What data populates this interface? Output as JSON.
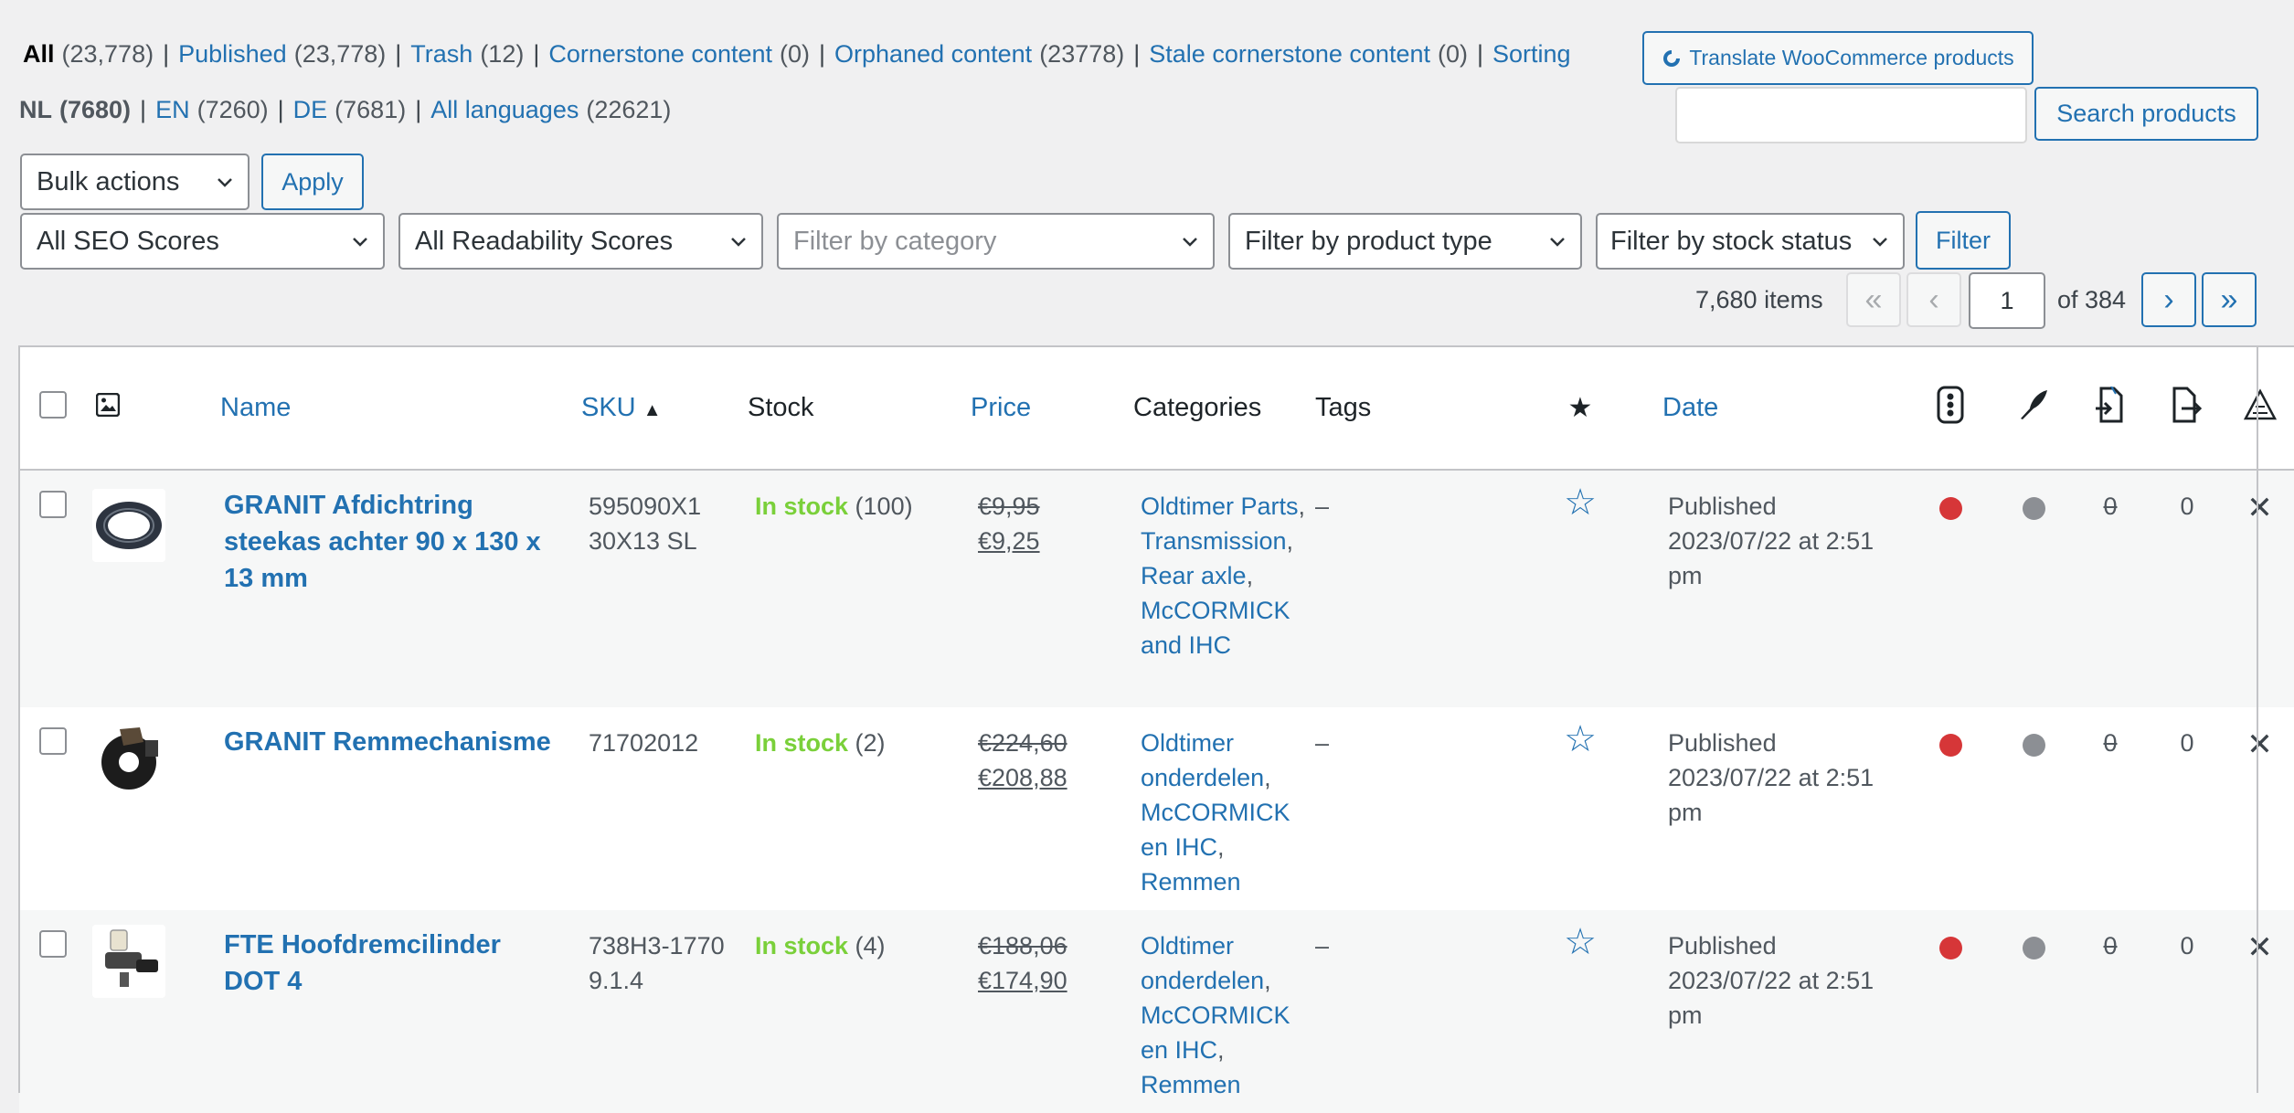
{
  "views": [
    {
      "label": "All",
      "count": "(23,778)",
      "current": true
    },
    {
      "label": "Published",
      "count": "(23,778)"
    },
    {
      "label": "Trash",
      "count": "(12)"
    },
    {
      "label": "Cornerstone content",
      "count": " (0)"
    },
    {
      "label": "Orphaned content",
      "count": " (23778)"
    },
    {
      "label": "Stale cornerstone content",
      "count": " (0)"
    },
    {
      "label": "Sorting",
      "count": ""
    }
  ],
  "translate_button": "Translate WooCommerce products",
  "languages": [
    {
      "label": "NL",
      "count": "(7680)",
      "current": true
    },
    {
      "label": "EN",
      "count": "(7260)"
    },
    {
      "label": "DE",
      "count": "(7681)"
    },
    {
      "label": "All languages",
      "count": "(22621)"
    }
  ],
  "search": {
    "value": "",
    "button": "Search products"
  },
  "bulk": {
    "selected": "Bulk actions",
    "apply": "Apply"
  },
  "filters": {
    "seo": "All SEO Scores",
    "readability": "All Readability Scores",
    "category": "Filter by category",
    "product_type": "Filter by product type",
    "stock": "Filter by stock status",
    "button": "Filter"
  },
  "pagination": {
    "items": "7,680 items",
    "first": "«",
    "prev": "‹",
    "current": "1",
    "of": "of 384",
    "next": "›",
    "last": "»"
  },
  "columns": {
    "name": "Name",
    "sku": "SKU",
    "stock": "Stock",
    "price": "Price",
    "categories": "Categories",
    "tags": "Tags",
    "date": "Date"
  },
  "icons": {
    "thumb": "image-icon",
    "featured": "star-icon",
    "seo": "traffic-light-icon",
    "readability": "quill-icon",
    "links_in": "incoming-links-icon",
    "links_out": "outgoing-links-icon",
    "translate": "translate-icon"
  },
  "colors": {
    "link": "#2271b1",
    "instock": "#7ad03a",
    "seo_bad": "#d63638",
    "readability_na": "#8c8f94"
  },
  "products": [
    {
      "name": "GRANIT Afdichtring steekas achter 90 x 130 x 13 mm",
      "sku": "595090X1 30X13 SL",
      "stock_label": "In stock",
      "stock_qty": "(100)",
      "price_old": "€9,95",
      "price_new": "€9,25",
      "categories": [
        "Oldtimer Parts",
        "Transmission",
        "Rear axle",
        "McCORMICK and IHC"
      ],
      "tags": "–",
      "date_status": "Published",
      "date": "2023/07/22 at 2:51 pm",
      "links_in": "0",
      "links_out": "0"
    },
    {
      "name": "GRANIT Remmechanisme",
      "sku": "71702012",
      "stock_label": "In stock",
      "stock_qty": "(2)",
      "price_old": "€224,60",
      "price_new": "€208,88",
      "categories": [
        "Oldtimer onderdelen",
        "McCORMICK en IHC",
        "Remmen"
      ],
      "tags": "–",
      "date_status": "Published",
      "date": "2023/07/22 at 2:51 pm",
      "links_in": "0",
      "links_out": "0"
    },
    {
      "name": "FTE Hoofdremcilinder DOT 4",
      "sku": "738H3-17709.1.4",
      "stock_label": "In stock",
      "stock_qty": "(4)",
      "price_old": "€188,06",
      "price_new": "€174,90",
      "categories": [
        "Oldtimer onderdelen",
        "McCORMICK en IHC",
        "Remmen"
      ],
      "tags": "–",
      "date_status": "Published",
      "date": "2023/07/22 at 2:51 pm",
      "links_in": "0",
      "links_out": "0"
    }
  ]
}
